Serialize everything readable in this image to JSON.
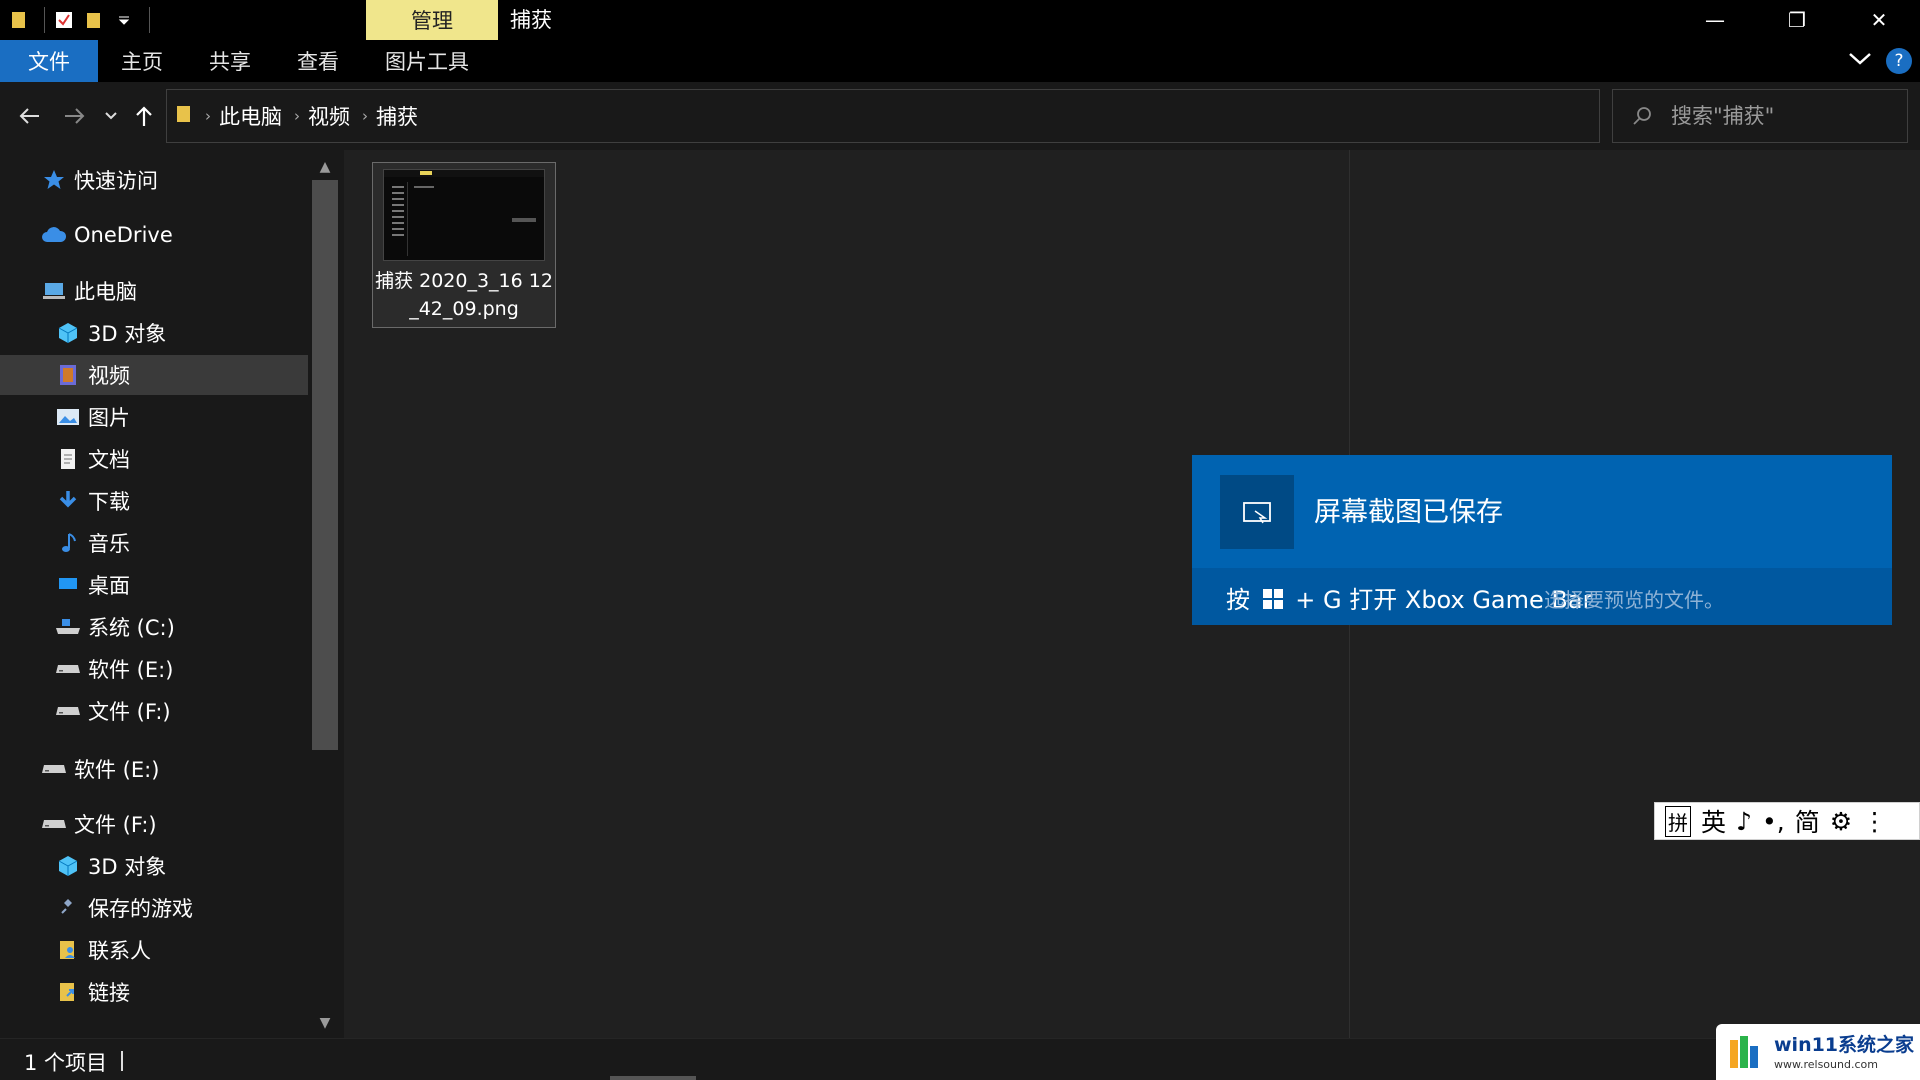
{
  "window": {
    "title": "捕获",
    "context_tab": "管理",
    "minimize": "—",
    "restore": "❐",
    "close": "✕"
  },
  "ribbon": {
    "tabs": [
      "文件",
      "主页",
      "共享",
      "查看",
      "图片工具"
    ]
  },
  "address": {
    "crumbs": [
      "此电脑",
      "视频",
      "捕获"
    ],
    "search_placeholder": "搜索\"捕获\""
  },
  "sidebar": {
    "items": [
      {
        "label": "快速访问",
        "icon": "star-icon"
      },
      {
        "label": "OneDrive",
        "icon": "cloud-icon"
      },
      {
        "label": "此电脑",
        "icon": "computer-icon"
      },
      {
        "label": "3D 对象",
        "icon": "cube-icon"
      },
      {
        "label": "视频",
        "icon": "video-icon"
      },
      {
        "label": "图片",
        "icon": "pictures-icon"
      },
      {
        "label": "文档",
        "icon": "document-icon"
      },
      {
        "label": "下载",
        "icon": "download-icon"
      },
      {
        "label": "音乐",
        "icon": "music-icon"
      },
      {
        "label": "桌面",
        "icon": "desktop-icon"
      },
      {
        "label": "系统 (C:)",
        "icon": "drive-c-icon"
      },
      {
        "label": "软件 (E:)",
        "icon": "drive-icon"
      },
      {
        "label": "文件 (F:)",
        "icon": "drive-icon"
      },
      {
        "label": "软件 (E:)",
        "icon": "drive-icon"
      },
      {
        "label": "文件 (F:)",
        "icon": "drive-icon"
      },
      {
        "label": "3D 对象",
        "icon": "cube-icon"
      },
      {
        "label": "保存的游戏",
        "icon": "saved-games-icon"
      },
      {
        "label": "联系人",
        "icon": "contacts-icon"
      },
      {
        "label": "链接",
        "icon": "links-icon"
      }
    ]
  },
  "files": [
    {
      "name": "捕获 2020_3_16 12_42_09.png"
    }
  ],
  "notification": {
    "title": "屏幕截图已保存",
    "hint_prefix": "按",
    "hint_suffix": "+ G 打开 Xbox Game Bar",
    "preview_text": "选择要预览的文件。"
  },
  "ime": {
    "items": [
      "拼",
      "英",
      "♪",
      "•,",
      "简",
      "⚙",
      "⋮"
    ]
  },
  "status": {
    "item_count": "1 个项目"
  },
  "watermark": {
    "title": "win11系统之家",
    "url": "www.relsound.com"
  },
  "colors": {
    "accent": "#1a6ec2",
    "manage_tab": "#f0e68c",
    "notification": "#0063b1"
  }
}
